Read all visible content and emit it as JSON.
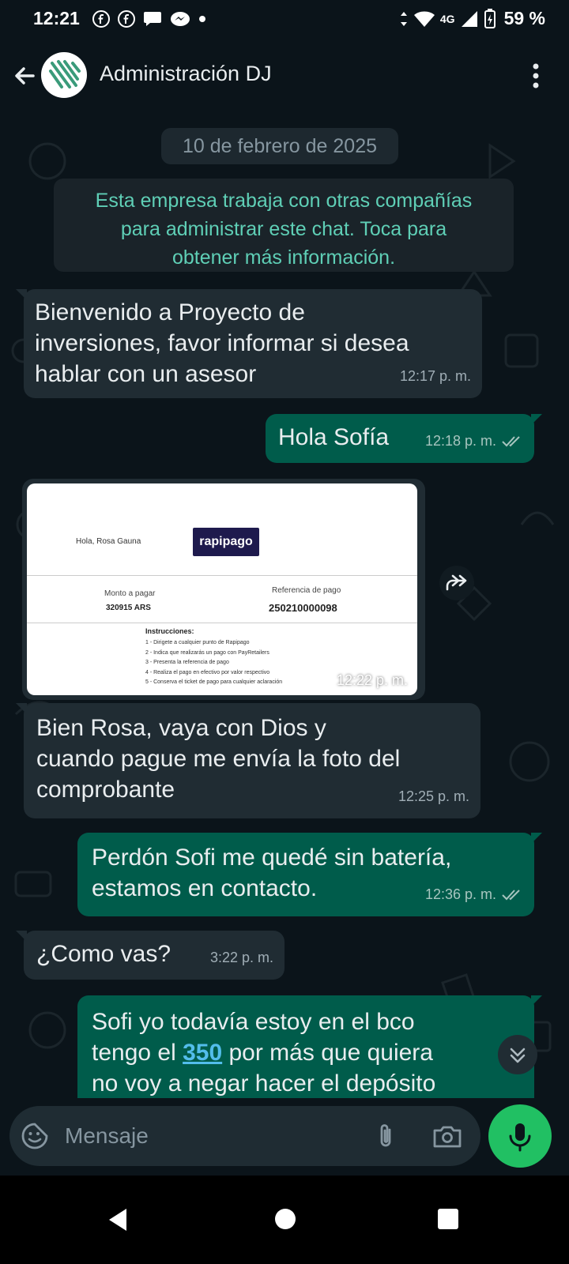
{
  "status_bar": {
    "time": "12:21",
    "network": "4G",
    "battery": "59 %",
    "notification_icons": [
      "facebook-icon",
      "facebook-icon",
      "chat-icon",
      "messenger-icon",
      "dot-icon"
    ]
  },
  "header": {
    "title": "Administración DJ",
    "avatar_icon": "business-logo-avatar"
  },
  "chat": {
    "date_chip": "10 de febrero de 2025",
    "system_note": "Esta empresa trabaja con otras compañías\npara administrar este chat. Toca para\nobtener más información.",
    "messages": [
      {
        "direction": "in",
        "text": "Bienvenido a  Proyecto de\ninversiones, favor informar si desea\nhablar con un asesor",
        "time": "12:17 p. m."
      },
      {
        "direction": "out",
        "text": "Hola Sofía",
        "time": "12:18 p. m.",
        "status": "read"
      },
      {
        "direction": "in",
        "type": "image",
        "time": "12:22 p. m."
      },
      {
        "direction": "in",
        "text": "Bien Rosa, vaya con Dios y\ncuando pague me envía la foto del\ncomprobante",
        "time": "12:25 p. m."
      },
      {
        "direction": "out",
        "text": "Perdón Sofi me quedé sin batería,\nestamos en contacto.",
        "time": "12:36 p. m.",
        "status": "read"
      },
      {
        "direction": "in",
        "text": "¿Como vas?",
        "time": "3:22 p. m."
      },
      {
        "direction": "out",
        "text_before": "Sofi yo todavía estoy en el bco\ntengo el ",
        "link": "350",
        "text_after": " por más que quiera\nno voy a negar hacer el depósito"
      }
    ],
    "image_content": {
      "greeting": "Hola, Rosa Gauna",
      "logo": "rapipago",
      "monto_label": "Monto a pagar",
      "monto_value": "320915 ARS",
      "ref_label": "Referencia de pago",
      "ref_value": "250210000098",
      "instructions_title": "Instrucciones:",
      "instructions": [
        "1 - Dirigete a cualquier punto de Rapipago",
        "2 - Indica que realizarás un pago con PayRetailers",
        "3 - Presenta la referencia de pago",
        "4 - Realiza el pago en efectivo por valor respectivo",
        "5 - Conserva el ticket de pago para cualquier aclaración"
      ]
    }
  },
  "composer": {
    "placeholder": "Mensaje"
  },
  "colors": {
    "background": "#0b141a",
    "incoming_bubble": "#202c33",
    "outgoing_bubble": "#005c4b",
    "accent_green": "#21c063",
    "system_text": "#5fcfb6",
    "link": "#53bdeb"
  }
}
